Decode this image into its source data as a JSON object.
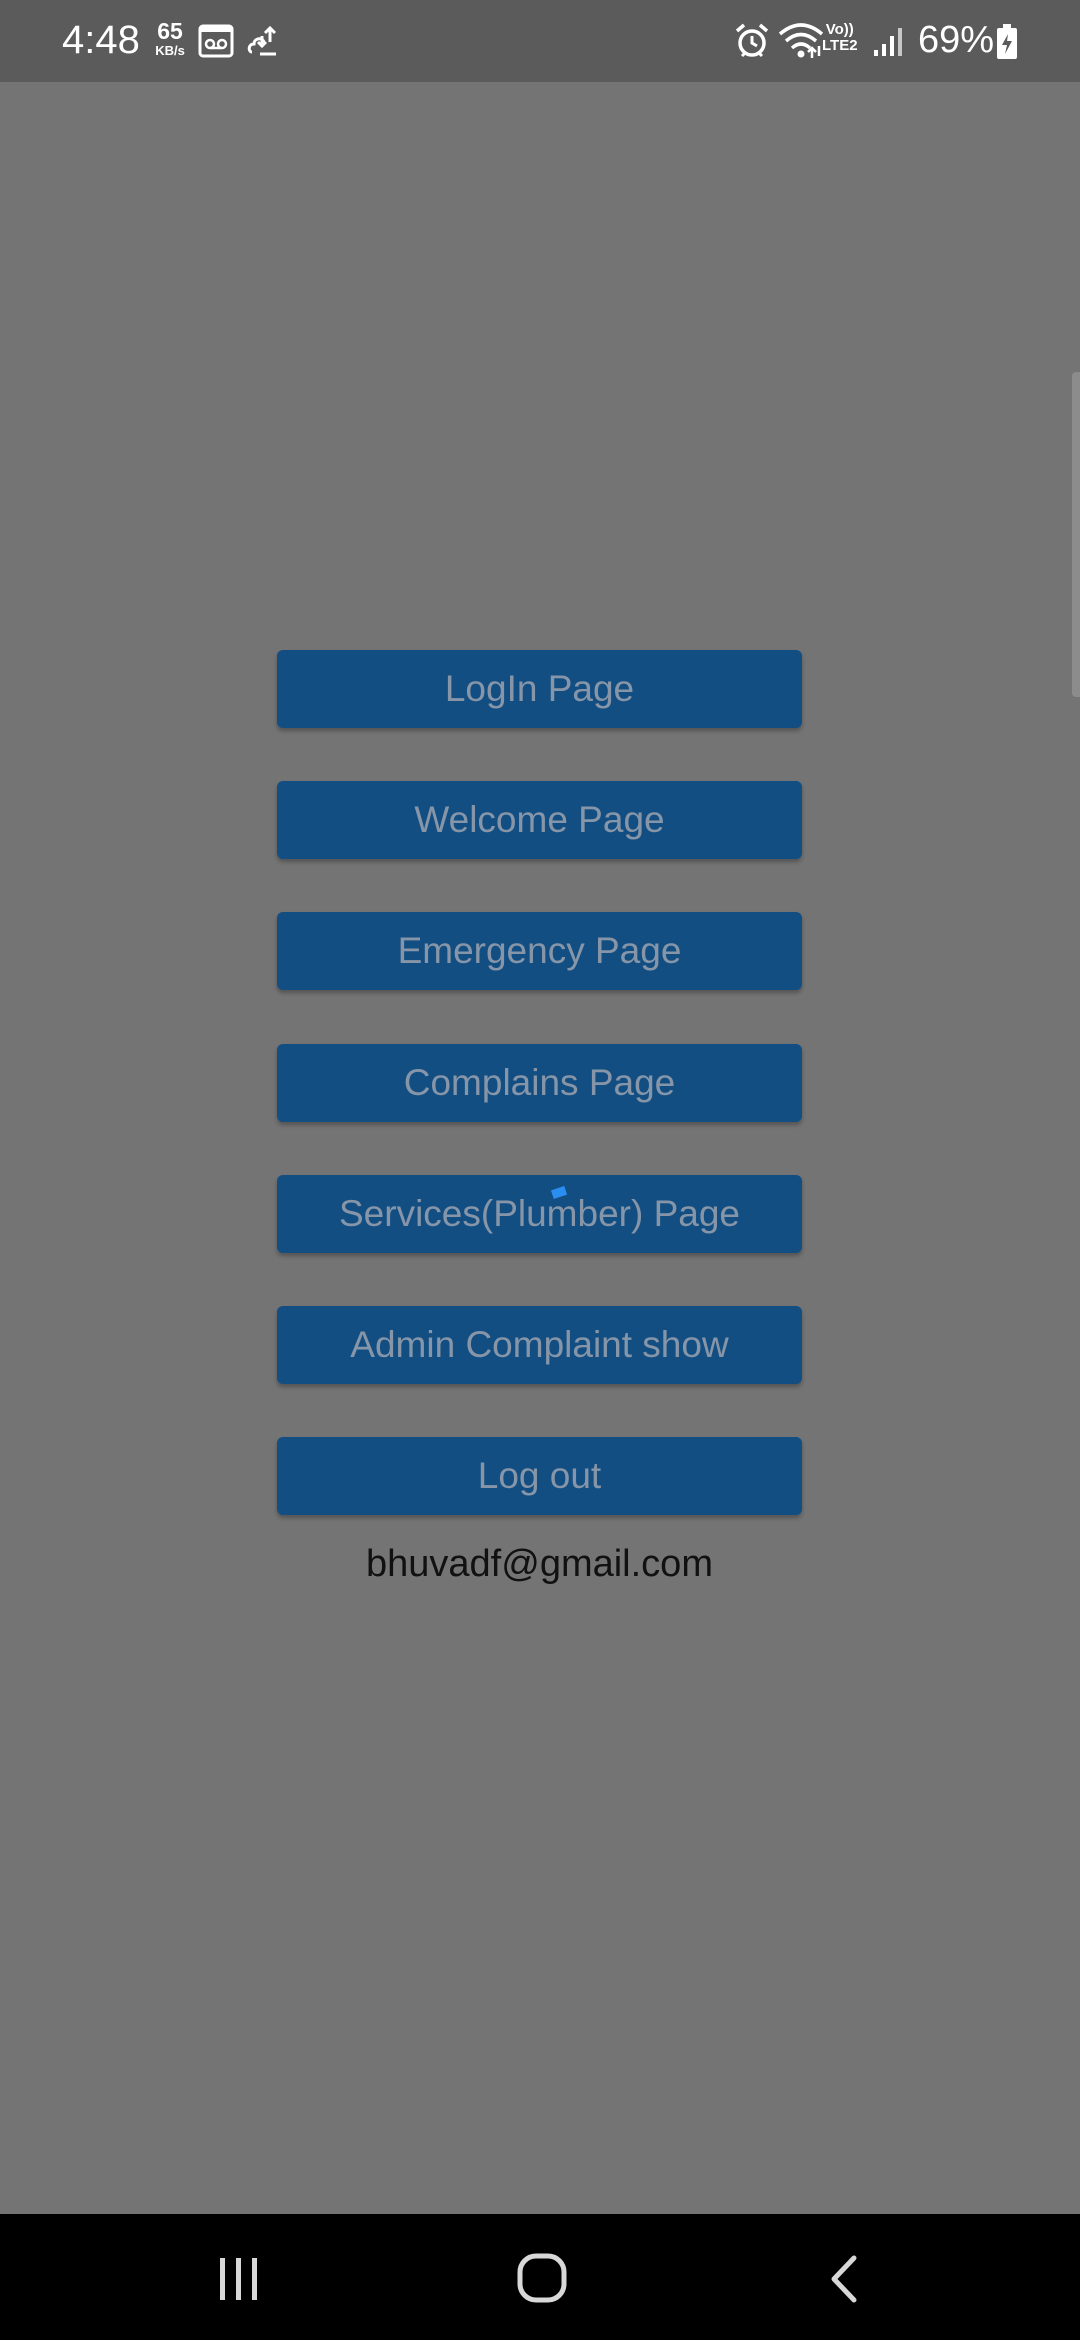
{
  "status_bar": {
    "time": "4:48",
    "net_speed_value": "65",
    "net_speed_unit": "KB/s",
    "network_label_top": "Vo))",
    "network_label_bottom": "LTE2",
    "battery": "69%"
  },
  "menu": {
    "buttons": [
      {
        "label": "LogIn Page"
      },
      {
        "label": "Welcome Page"
      },
      {
        "label": "Emergency Page"
      },
      {
        "label": "Complains Page"
      },
      {
        "label": "Services(Plumber) Page"
      },
      {
        "label": "Admin Complaint show"
      },
      {
        "label": "Log out"
      }
    ],
    "user_email": "bhuvadf@gmail.com"
  },
  "icons": {
    "status": [
      "voicemail-icon",
      "cloud-sync-icon",
      "alarm-icon",
      "wifi-icon",
      "signal-icon",
      "battery-charging-icon"
    ],
    "navigation": [
      "recent-apps-icon",
      "home-icon",
      "back-icon"
    ]
  },
  "colors": {
    "background": "#747474",
    "status_bar": "#5b5b5b",
    "button": "#134e83",
    "button_text": "#8696a8",
    "nav_bar": "#000000"
  }
}
